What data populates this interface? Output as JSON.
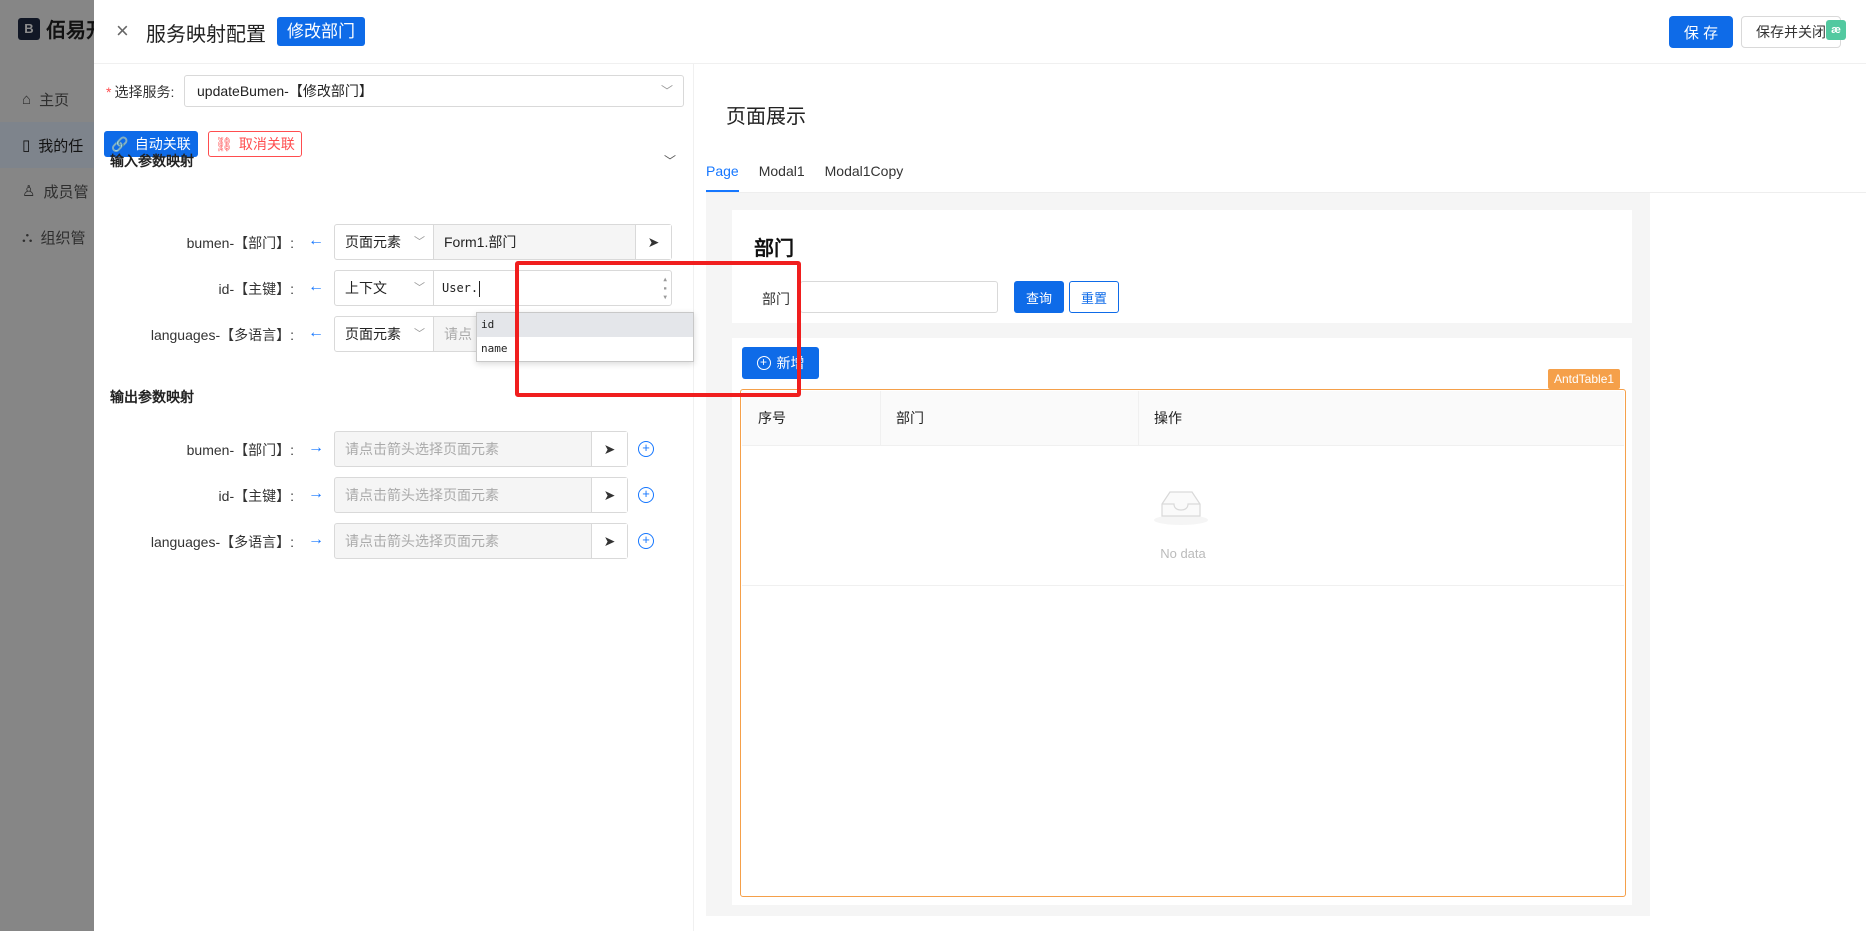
{
  "background_app": {
    "logo_text": "佰易开",
    "nav": [
      {
        "icon": "home-icon",
        "label": "主页"
      },
      {
        "icon": "file-icon",
        "label": "我的任"
      },
      {
        "icon": "user-icon",
        "label": "成员管"
      },
      {
        "icon": "org-icon",
        "label": "组织管"
      }
    ]
  },
  "header": {
    "close_glyph": "×",
    "title": "服务映射配置",
    "tag": "修改部门",
    "save_label": "保 存",
    "save_close_label": "保存并关闭",
    "corner_badge": "æ"
  },
  "service": {
    "label": "选择服务:",
    "value": "updateBumen-【修改部门】"
  },
  "link_buttons": {
    "auto": "自动关联",
    "cancel": "取消关联"
  },
  "input_mapping": {
    "title": "输入参数映射",
    "rows": [
      {
        "label": "bumen-【部门】:",
        "type": "页面元素",
        "value": "Form1.部门"
      },
      {
        "label": "id-【主键】:",
        "type": "上下文",
        "code": "User."
      },
      {
        "label": "languages-【多语言】:",
        "type": "页面元素",
        "placeholder": "请点"
      }
    ]
  },
  "autocomplete": {
    "items": [
      "id",
      "name"
    ],
    "selected": "id"
  },
  "output_mapping": {
    "title": "输出参数映射",
    "placeholder": "请点击箭头选择页面元素",
    "rows": [
      {
        "label": "bumen-【部门】:"
      },
      {
        "label": "id-【主键】:"
      },
      {
        "label": "languages-【多语言】:"
      }
    ]
  },
  "preview": {
    "title": "页面展示",
    "tabs": [
      "Page",
      "Modal1",
      "Modal1Copy"
    ],
    "active_tab": "Page",
    "search_card": {
      "title": "部门",
      "field_label": "部门",
      "query_label": "查询",
      "reset_label": "重置"
    },
    "table": {
      "add_label": "新增",
      "component_badge": "AntdTable1",
      "columns": [
        "序号",
        "部门",
        "操作"
      ],
      "empty_text": "No data"
    }
  }
}
